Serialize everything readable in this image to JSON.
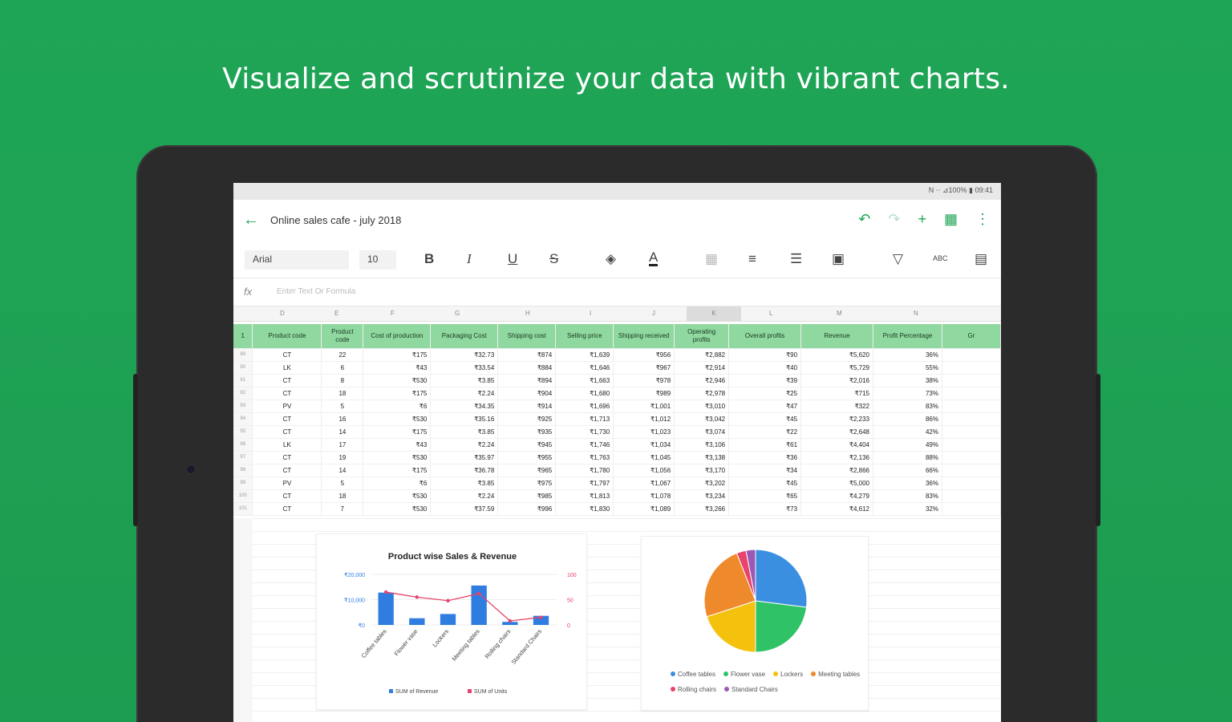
{
  "headline": "Visualize and scrutinize your data with vibrant charts.",
  "status": {
    "text": "N ⋅⋅ ⊿100% ▮ 09:41"
  },
  "appbar": {
    "title": "Online sales cafe - july 2018"
  },
  "toolbar": {
    "font": "Arial",
    "size": "10",
    "bold": "B",
    "italic": "I",
    "underline": "U",
    "strike": "S",
    "textcolor": "A"
  },
  "formula": {
    "fx": "fx",
    "placeholder": "Enter Text Or Formula"
  },
  "columns": [
    "D",
    "E",
    "F",
    "G",
    "H",
    "I",
    "J",
    "K",
    "L",
    "M",
    "N"
  ],
  "header_row": [
    "Product code",
    "Product code",
    "Cost of production",
    "Packaging Cost",
    "Shipping cost",
    "Selling price",
    "Shipping received",
    "Operating profits",
    "Overall profits",
    "Revenue",
    "Profit Percentage",
    "Gr"
  ],
  "rows": [
    [
      "89",
      "CT",
      "22",
      "₹175",
      "₹32.73",
      "₹874",
      "₹1,639",
      "₹956",
      "₹2,882",
      "₹90",
      "₹5,620",
      "36%"
    ],
    [
      "90",
      "LK",
      "6",
      "₹43",
      "₹33.54",
      "₹884",
      "₹1,646",
      "₹967",
      "₹2,914",
      "₹40",
      "₹5,729",
      "55%"
    ],
    [
      "91",
      "CT",
      "8",
      "₹530",
      "₹3.85",
      "₹894",
      "₹1,663",
      "₹978",
      "₹2,946",
      "₹39",
      "₹2,016",
      "38%"
    ],
    [
      "92",
      "CT",
      "18",
      "₹175",
      "₹2.24",
      "₹904",
      "₹1,680",
      "₹989",
      "₹2,978",
      "₹25",
      "₹715",
      "73%"
    ],
    [
      "93",
      "PV",
      "5",
      "₹6",
      "₹34.35",
      "₹914",
      "₹1,696",
      "₹1,001",
      "₹3,010",
      "₹47",
      "₹322",
      "83%"
    ],
    [
      "94",
      "CT",
      "16",
      "₹530",
      "₹35.16",
      "₹925",
      "₹1,713",
      "₹1,012",
      "₹3,042",
      "₹45",
      "₹2,233",
      "86%"
    ],
    [
      "95",
      "CT",
      "14",
      "₹175",
      "₹3.85",
      "₹935",
      "₹1,730",
      "₹1,023",
      "₹3,074",
      "₹22",
      "₹2,648",
      "42%"
    ],
    [
      "96",
      "LK",
      "17",
      "₹43",
      "₹2.24",
      "₹945",
      "₹1,746",
      "₹1,034",
      "₹3,106",
      "₹61",
      "₹4,404",
      "49%"
    ],
    [
      "97",
      "CT",
      "19",
      "₹530",
      "₹35.97",
      "₹955",
      "₹1,763",
      "₹1,045",
      "₹3,138",
      "₹36",
      "₹2,136",
      "88%"
    ],
    [
      "98",
      "CT",
      "14",
      "₹175",
      "₹36.78",
      "₹965",
      "₹1,780",
      "₹1,056",
      "₹3,170",
      "₹34",
      "₹2,866",
      "66%"
    ],
    [
      "99",
      "PV",
      "5",
      "₹6",
      "₹3.85",
      "₹975",
      "₹1,797",
      "₹1,067",
      "₹3,202",
      "₹45",
      "₹5,000",
      "36%"
    ],
    [
      "100",
      "CT",
      "18",
      "₹530",
      "₹2.24",
      "₹985",
      "₹1,813",
      "₹1,078",
      "₹3,234",
      "₹65",
      "₹4,279",
      "83%"
    ],
    [
      "101",
      "CT",
      "7",
      "₹530",
      "₹37.59",
      "₹996",
      "₹1,830",
      "₹1,089",
      "₹3,266",
      "₹73",
      "₹4,612",
      "32%"
    ]
  ],
  "chart_data": [
    {
      "type": "bar",
      "title": "Product wise Sales & Revenue",
      "categories": [
        "Coffee tables",
        "Flower vase",
        "Lockers",
        "Meeting tables",
        "Rolling chairs",
        "Standard Chairs"
      ],
      "yticks_left": [
        "₹0",
        "₹10,000",
        "₹20,000"
      ],
      "yticks_right": [
        "0",
        "50",
        "100"
      ],
      "ylim": [
        0,
        25000
      ],
      "ylim_right": [
        0,
        100
      ],
      "series": [
        {
          "name": "SUM of Revenue",
          "kind": "bar",
          "color": "#2f7de0",
          "values": [
            16000,
            3300,
            5400,
            19500,
            1500,
            4500
          ]
        },
        {
          "name": "SUM of Units",
          "kind": "line",
          "color": "#e8436a",
          "values": [
            65,
            55,
            48,
            62,
            8,
            15
          ]
        }
      ]
    },
    {
      "type": "pie",
      "legend": [
        "Coffee tables",
        "Flower vase",
        "Lockers",
        "Meeting tables",
        "Rolling chairs",
        "Standard Chairs"
      ],
      "series": [
        {
          "name": "Coffee tables",
          "value": 27,
          "color": "#3b8fe0"
        },
        {
          "name": "Flower vase",
          "value": 23,
          "color": "#2fc266"
        },
        {
          "name": "Lockers",
          "value": 20,
          "color": "#f4c20d"
        },
        {
          "name": "Meeting tables",
          "value": 24,
          "color": "#ef8a2c"
        },
        {
          "name": "Rolling chairs",
          "value": 3,
          "color": "#e8436a"
        },
        {
          "name": "Standard Chairs",
          "value": 3,
          "color": "#9b59b6"
        }
      ]
    }
  ]
}
